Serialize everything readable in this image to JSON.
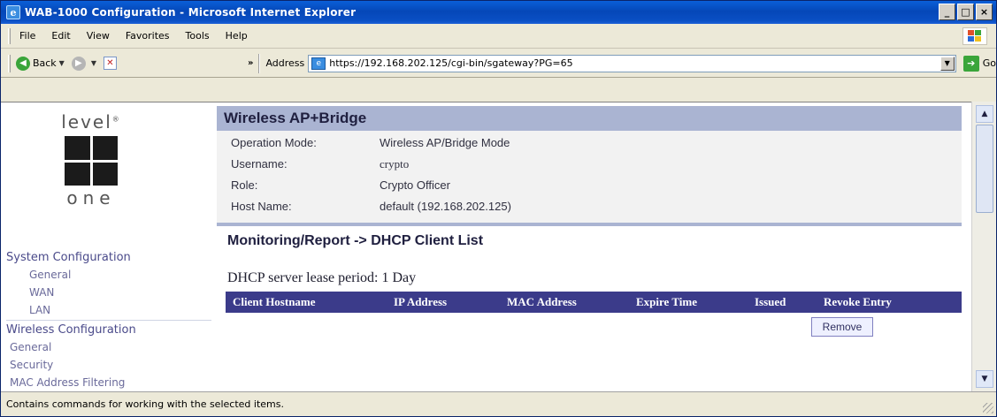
{
  "window": {
    "title": "WAB-1000 Configuration - Microsoft Internet Explorer",
    "controls": [
      "_",
      "□",
      "×"
    ]
  },
  "menu": {
    "items": [
      "File",
      "Edit",
      "View",
      "Favorites",
      "Tools",
      "Help"
    ]
  },
  "toolbar": {
    "back_label": "Back",
    "chevron": "»",
    "address_label": "Address",
    "address_url": "https://192.168.202.125/cgi-bin/sgateway?PG=65",
    "go_label": "Go"
  },
  "sidebar": {
    "logo": {
      "top": "level",
      "sup": "®",
      "bottom": "one"
    },
    "system_header": "System Configuration",
    "system_items": [
      "General",
      "WAN",
      "LAN"
    ],
    "wireless_header": "Wireless Configuration",
    "wireless_items": [
      "General",
      "Security",
      "MAC Address Filtering"
    ]
  },
  "main": {
    "header": "Wireless AP+Bridge",
    "info": {
      "rows": [
        {
          "label": "Operation Mode:",
          "value": "Wireless AP/Bridge Mode"
        },
        {
          "label": "Username:",
          "value": "crypto"
        },
        {
          "label": "Role:",
          "value": "Crypto Officer"
        },
        {
          "label": "Host Name:",
          "value": "default (192.168.202.125)"
        }
      ]
    },
    "section_title": "Monitoring/Report -> DHCP Client List",
    "lease_text": "DHCP server lease period: 1 Day",
    "table": {
      "columns": [
        "Client Hostname",
        "IP Address",
        "MAC Address",
        "Expire Time",
        "Issued",
        "Revoke Entry"
      ],
      "rows": []
    },
    "remove_label": "Remove"
  },
  "status": {
    "text": "Contains commands for working with the selected items."
  },
  "colors": {
    "titlebar": "#0547b8",
    "header_bg": "#aab4d2",
    "table_header": "#3b3b8a"
  }
}
